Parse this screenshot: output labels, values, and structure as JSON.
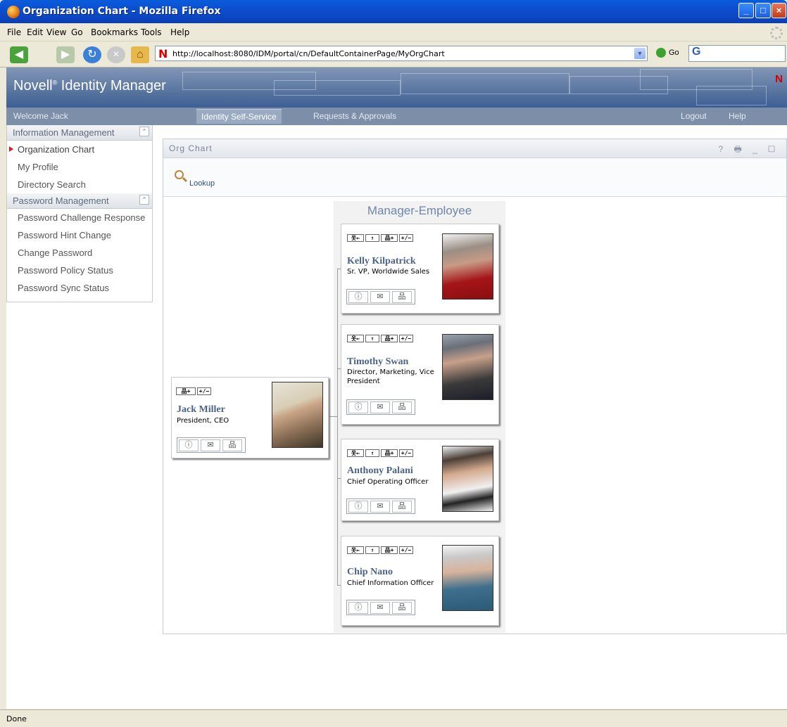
{
  "window": {
    "title": "Organization Chart - Mozilla Firefox"
  },
  "menu": [
    "File",
    "Edit",
    "View",
    "Go",
    "Bookmarks",
    "Tools",
    "Help"
  ],
  "toolbar": {
    "url": "http://localhost:8080/IDM/portal/cn/DefaultContainerPage/MyOrgChart",
    "go_label": "Go",
    "search_logo": "G"
  },
  "banner": {
    "product_name": "Novell",
    "product_suffix": "Identity Manager",
    "mark": "®",
    "brand_letter": "N"
  },
  "tabs": {
    "welcome": "Welcome Jack",
    "self_service": "Identity Self-Service",
    "requests": "Requests & Approvals",
    "logout": "Logout",
    "help": "Help"
  },
  "sidebar": {
    "sections": [
      {
        "title": "Information Management",
        "items": [
          "Organization Chart",
          "My Profile",
          "Directory Search"
        ]
      },
      {
        "title": "Password Management",
        "items": [
          "Password Challenge Response",
          "Password Hint Change",
          "Change Password",
          "Password Policy Status",
          "Password Sync Status"
        ]
      }
    ]
  },
  "portlet": {
    "title": "Org Chart",
    "icons": "? 🖶 _ ☐",
    "lookup_label": "Lookup"
  },
  "chart": {
    "relationship_title": "Manager-Employee",
    "toolbar_buttons": {
      "user_up": "옷←",
      "up": "↑",
      "org": "品+",
      "expand": "+/−"
    },
    "action_icons": {
      "info": "ⓘ",
      "email": "✉",
      "org": "品"
    },
    "root": {
      "name": "Jack Miller",
      "title": "President, CEO"
    },
    "reports": [
      {
        "name": "Kelly Kilpatrick",
        "title": "Sr. VP, Worldwide Sales"
      },
      {
        "name": "Timothy Swan",
        "title": "Director, Marketing, Vice President"
      },
      {
        "name": "Anthony Palani",
        "title": "Chief Operating Officer"
      },
      {
        "name": "Chip Nano",
        "title": "Chief Information Officer"
      }
    ]
  },
  "status": {
    "text": "Done"
  },
  "colors": {
    "banner": "#5f7aa3",
    "name_text": "#4b6389",
    "titlebar": "#0a5ddb"
  }
}
